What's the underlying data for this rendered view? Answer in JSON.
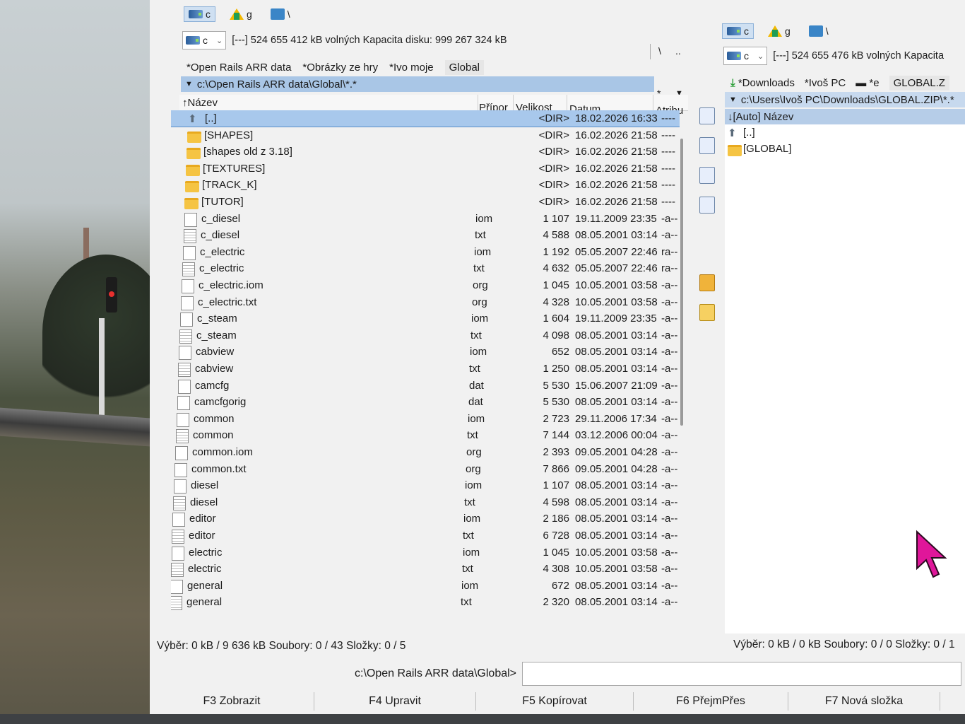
{
  "left_panel": {
    "drives": [
      "c",
      "g",
      "\\"
    ],
    "drive_combo": "c",
    "free_info": "[---]  524 655 412 kB volných  Kapacita disku: 999 267 324 kB",
    "path_tools": [
      "\\",
      ".."
    ],
    "tabs": [
      "*Open Rails ARR data",
      "*Obrázky ze hry",
      "*Ivo moje",
      "Global"
    ],
    "path": "c:\\Open Rails ARR data\\Global\\*.*",
    "path_extra": [
      "*",
      "▼"
    ],
    "columns": {
      "name": "↑Název",
      "ext": "Přípor",
      "size": "Velikost",
      "date": "Datum",
      "attr": "Atribu"
    },
    "rows": [
      {
        "name": "[..]",
        "ext": "",
        "size": "<DIR>",
        "date": "18.02.2026 16:33",
        "attr": "----",
        "type": "up"
      },
      {
        "name": "[SHAPES]",
        "ext": "",
        "size": "<DIR>",
        "date": "16.02.2026 21:58",
        "attr": "----",
        "type": "folder"
      },
      {
        "name": "[shapes old z 3.18]",
        "ext": "",
        "size": "<DIR>",
        "date": "16.02.2026 21:58",
        "attr": "----",
        "type": "folder"
      },
      {
        "name": "[TEXTURES]",
        "ext": "",
        "size": "<DIR>",
        "date": "16.02.2026 21:58",
        "attr": "----",
        "type": "folder"
      },
      {
        "name": "[TRACK_K]",
        "ext": "",
        "size": "<DIR>",
        "date": "16.02.2026 21:58",
        "attr": "----",
        "type": "folder"
      },
      {
        "name": "[TUTOR]",
        "ext": "",
        "size": "<DIR>",
        "date": "16.02.2026 21:58",
        "attr": "----",
        "type": "folder"
      },
      {
        "name": "c_diesel",
        "ext": "iom",
        "size": "1 107",
        "date": "19.11.2009 23:35",
        "attr": "-a--",
        "type": "doc"
      },
      {
        "name": "c_diesel",
        "ext": "txt",
        "size": "4 588",
        "date": "08.05.2001 03:14",
        "attr": "-a--",
        "type": "txt"
      },
      {
        "name": "c_electric",
        "ext": "iom",
        "size": "1 192",
        "date": "05.05.2007 22:46",
        "attr": "ra--",
        "type": "doc"
      },
      {
        "name": "c_electric",
        "ext": "txt",
        "size": "4 632",
        "date": "05.05.2007 22:46",
        "attr": "ra--",
        "type": "txt"
      },
      {
        "name": "c_electric.iom",
        "ext": "org",
        "size": "1 045",
        "date": "10.05.2001 03:58",
        "attr": "-a--",
        "type": "doc"
      },
      {
        "name": "c_electric.txt",
        "ext": "org",
        "size": "4 328",
        "date": "10.05.2001 03:58",
        "attr": "-a--",
        "type": "doc"
      },
      {
        "name": "c_steam",
        "ext": "iom",
        "size": "1 604",
        "date": "19.11.2009 23:35",
        "attr": "-a--",
        "type": "doc"
      },
      {
        "name": "c_steam",
        "ext": "txt",
        "size": "4 098",
        "date": "08.05.2001 03:14",
        "attr": "-a--",
        "type": "txt"
      },
      {
        "name": "cabview",
        "ext": "iom",
        "size": "652",
        "date": "08.05.2001 03:14",
        "attr": "-a--",
        "type": "doc"
      },
      {
        "name": "cabview",
        "ext": "txt",
        "size": "1 250",
        "date": "08.05.2001 03:14",
        "attr": "-a--",
        "type": "txt"
      },
      {
        "name": "camcfg",
        "ext": "dat",
        "size": "5 530",
        "date": "15.06.2007 21:09",
        "attr": "-a--",
        "type": "doc"
      },
      {
        "name": "camcfgorig",
        "ext": "dat",
        "size": "5 530",
        "date": "08.05.2001 03:14",
        "attr": "-a--",
        "type": "doc"
      },
      {
        "name": "common",
        "ext": "iom",
        "size": "2 723",
        "date": "29.11.2006 17:34",
        "attr": "-a--",
        "type": "doc"
      },
      {
        "name": "common",
        "ext": "txt",
        "size": "7 144",
        "date": "03.12.2006 00:04",
        "attr": "-a--",
        "type": "txt"
      },
      {
        "name": "common.iom",
        "ext": "org",
        "size": "2 393",
        "date": "09.05.2001 04:28",
        "attr": "-a--",
        "type": "doc"
      },
      {
        "name": "common.txt",
        "ext": "org",
        "size": "7 866",
        "date": "09.05.2001 04:28",
        "attr": "-a--",
        "type": "doc"
      },
      {
        "name": "diesel",
        "ext": "iom",
        "size": "1 107",
        "date": "08.05.2001 03:14",
        "attr": "-a--",
        "type": "doc"
      },
      {
        "name": "diesel",
        "ext": "txt",
        "size": "4 598",
        "date": "08.05.2001 03:14",
        "attr": "-a--",
        "type": "txt"
      },
      {
        "name": "editor",
        "ext": "iom",
        "size": "2 186",
        "date": "08.05.2001 03:14",
        "attr": "-a--",
        "type": "doc"
      },
      {
        "name": "editor",
        "ext": "txt",
        "size": "6 728",
        "date": "08.05.2001 03:14",
        "attr": "-a--",
        "type": "txt"
      },
      {
        "name": "electric",
        "ext": "iom",
        "size": "1 045",
        "date": "10.05.2001 03:58",
        "attr": "-a--",
        "type": "doc"
      },
      {
        "name": "electric",
        "ext": "txt",
        "size": "4 308",
        "date": "10.05.2001 03:58",
        "attr": "-a--",
        "type": "txt"
      },
      {
        "name": "general",
        "ext": "iom",
        "size": "672",
        "date": "08.05.2001 03:14",
        "attr": "-a--",
        "type": "doc"
      },
      {
        "name": "general",
        "ext": "txt",
        "size": "2 320",
        "date": "08.05.2001 03:14",
        "attr": "-a--",
        "type": "txt"
      }
    ],
    "status": "Výběr: 0 kB / 9 636 kB  Soubory: 0 / 43  Složky: 0 / 5"
  },
  "right_panel": {
    "drives": [
      "c",
      "g",
      "\\"
    ],
    "drive_combo": "c",
    "free_info": "[---]  524 655 476 kB volných  Kapacita",
    "tabs": [
      "*Downloads",
      "*Ivoš PC",
      "*e",
      "GLOBAL.Z"
    ],
    "path": "c:\\Users\\Ivoš PC\\Downloads\\GLOBAL.ZIP\\*.*",
    "column_head": "↓[Auto] Název",
    "rows": [
      {
        "name": "[..]",
        "type": "up"
      },
      {
        "name": "[GLOBAL]",
        "type": "folder"
      }
    ],
    "status": "Výběr: 0 kB / 0 kB  Soubory: 0 / 0  Složky: 0 / 1"
  },
  "toolbar_icons": [
    "view-icon",
    "edit-icon",
    "copy-icon",
    "move-icon",
    "pack-icon",
    "new-folder-icon"
  ],
  "command_line": {
    "prompt": "c:\\Open Rails ARR data\\Global>"
  },
  "function_keys": [
    "F3 Zobrazit",
    "F4 Upravit",
    "F5 Kopírovat",
    "F6 PřejmPřes",
    "F7 Nová složka"
  ],
  "colors": {
    "selection": "#a8c8ec",
    "path_bar": "#a9c6e6",
    "folder": "#f5c443",
    "cursor": "#e0169a"
  }
}
